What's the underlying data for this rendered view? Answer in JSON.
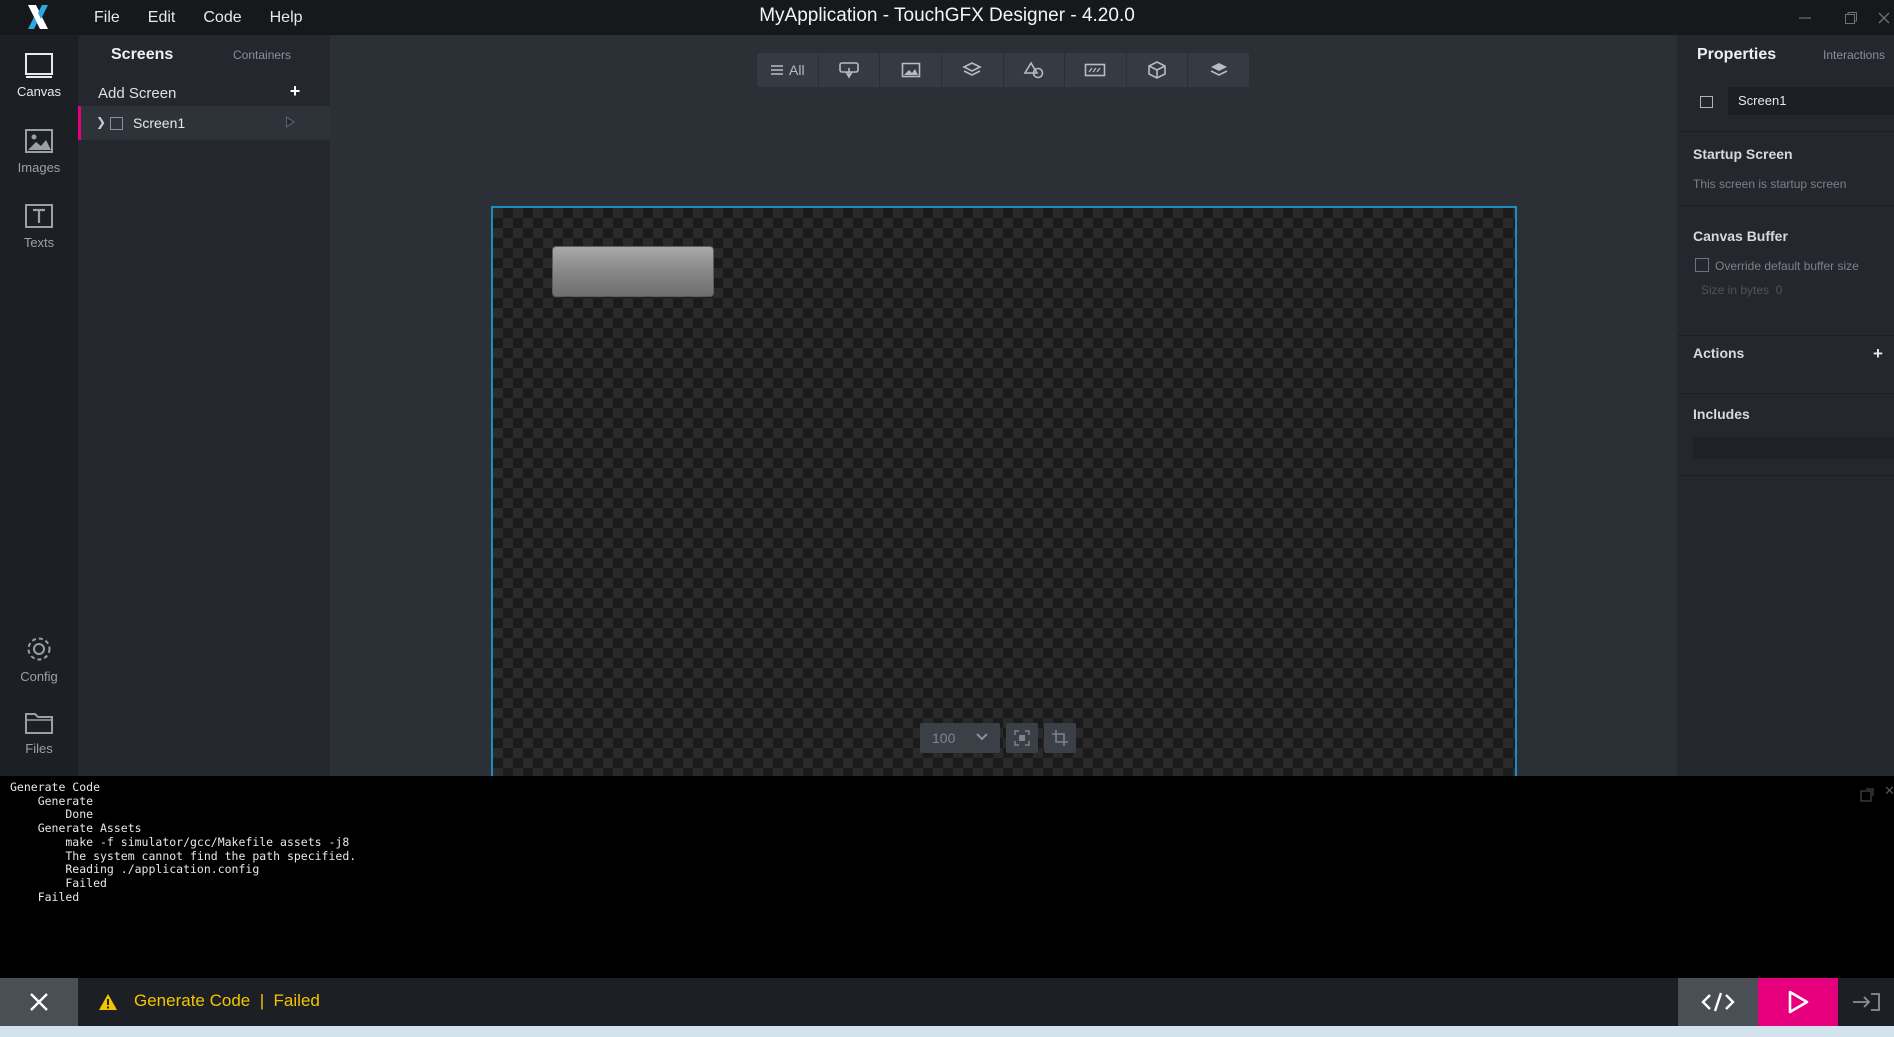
{
  "titlebar": {
    "title": "MyApplication - TouchGFX Designer - 4.20.0",
    "menu": [
      "File",
      "Edit",
      "Code",
      "Help"
    ]
  },
  "leftnav": {
    "items": [
      {
        "label": "Canvas",
        "icon": "canvas-icon"
      },
      {
        "label": "Images",
        "icon": "images-icon"
      },
      {
        "label": "Texts",
        "icon": "texts-icon"
      },
      {
        "label": "Config",
        "icon": "gear-icon"
      },
      {
        "label": "Files",
        "icon": "folder-icon"
      }
    ]
  },
  "screens_panel": {
    "tab_screens": "Screens",
    "tab_containers": "Containers",
    "add_screen_label": "Add Screen",
    "add_icon": "+",
    "screens": [
      {
        "label": "Screen1"
      }
    ]
  },
  "toolbar": {
    "all_label": "All",
    "tools": [
      "all-filter",
      "interaction-widget",
      "image-widget",
      "container-widget",
      "shapes-widget",
      "keyboard-widget",
      "3d-widget",
      "layers-widget"
    ]
  },
  "zoom": {
    "value": "100"
  },
  "properties": {
    "title": "Properties",
    "interactions_tab": "Interactions",
    "screen_name": "Screen1",
    "startup_screen_heading": "Startup Screen",
    "startup_screen_text": "This screen is startup screen",
    "canvas_buffer_heading": "Canvas Buffer",
    "override_label": "Override default buffer size",
    "size_label": "Size in bytes",
    "size_value": "0",
    "actions_heading": "Actions",
    "actions_add": "+",
    "includes_heading": "Includes"
  },
  "console": {
    "lines": [
      "Generate Code",
      "    Generate",
      "        Done",
      "    Generate Assets",
      "        make -f simulator/gcc/Makefile assets -j8",
      "        The system cannot find the path specified.",
      "        Reading ./application.config",
      "        Failed",
      "    Failed"
    ]
  },
  "status": {
    "text": "Generate Code  |  Failed",
    "color": "#f5c400"
  },
  "colors": {
    "accent": "#e6007e",
    "frame_border": "#1d8cc4"
  }
}
